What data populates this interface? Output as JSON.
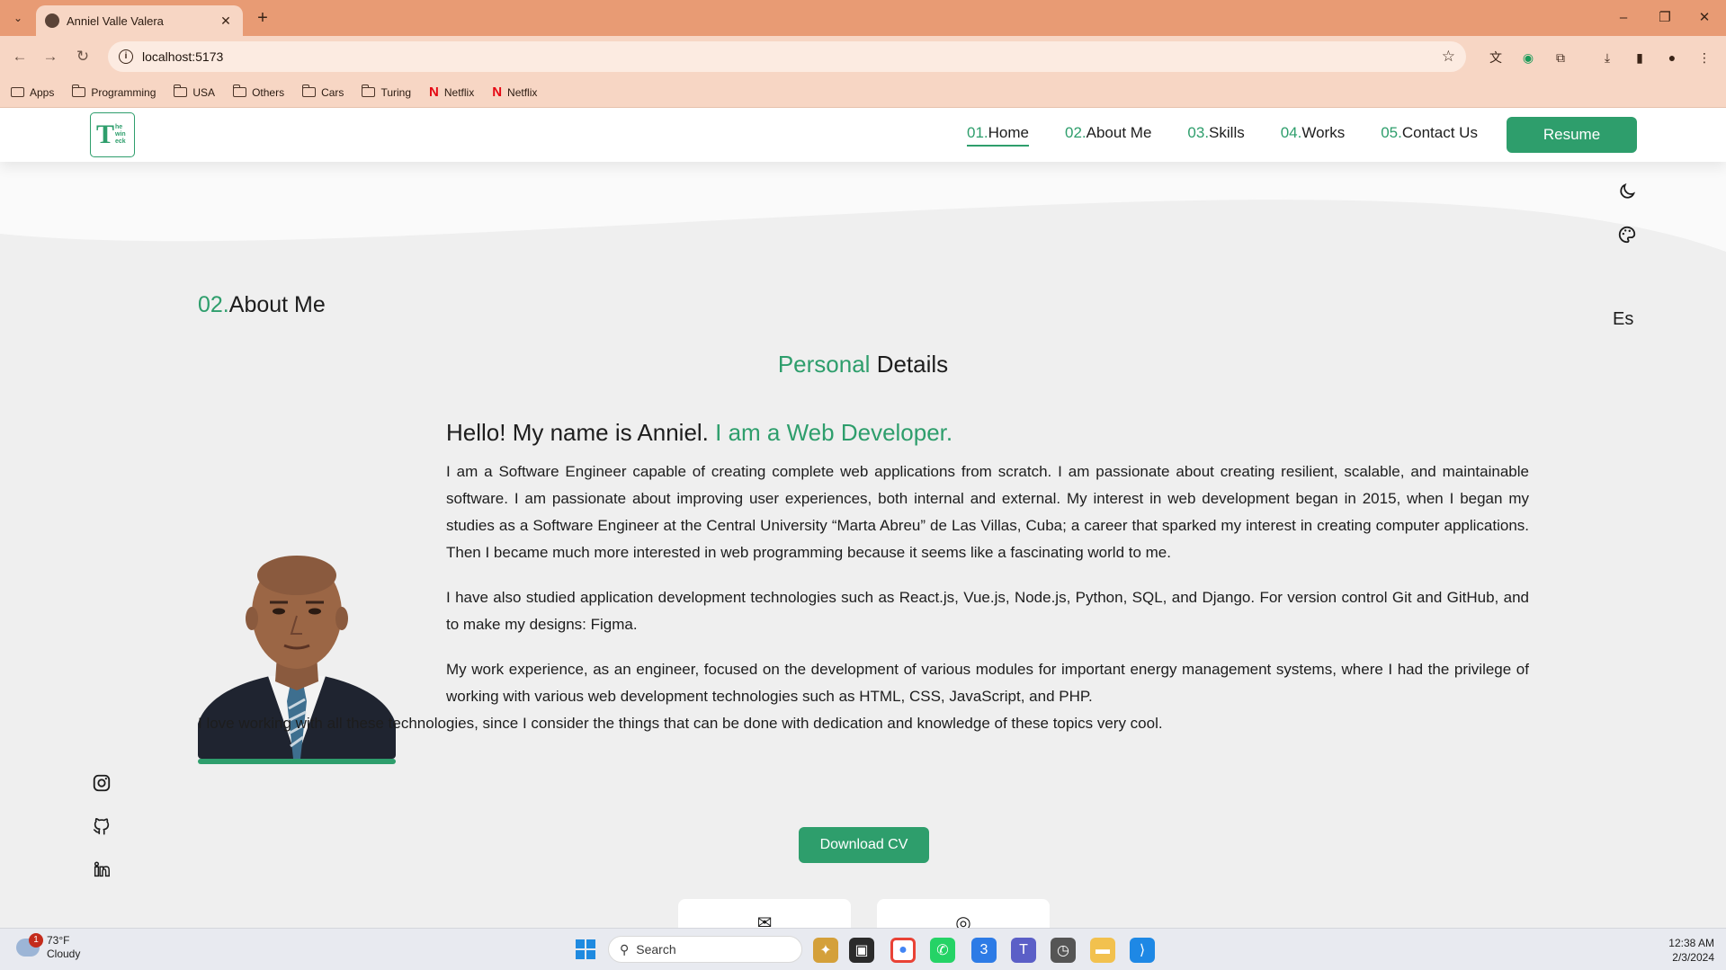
{
  "browser": {
    "tab_title": "Anniel Valle Valera",
    "url": "localhost:5173",
    "bookmarks": [
      {
        "label": "Apps",
        "icon": "apps-icon"
      },
      {
        "label": "Programming",
        "icon": "folder-icon"
      },
      {
        "label": "USA",
        "icon": "folder-icon"
      },
      {
        "label": "Others",
        "icon": "folder-icon"
      },
      {
        "label": "Cars",
        "icon": "folder-icon"
      },
      {
        "label": "Turing",
        "icon": "folder-icon"
      },
      {
        "label": "Netflix",
        "icon": "netflix-icon"
      },
      {
        "label": "Netflix",
        "icon": "netflix-icon"
      }
    ],
    "theme_color": "#e89b74"
  },
  "site": {
    "logo_letter": "T",
    "logo_small": [
      "he",
      "win",
      "eck"
    ],
    "nav": [
      {
        "num": "01.",
        "label": "Home",
        "active": true
      },
      {
        "num": "02.",
        "label": "About Me",
        "active": false
      },
      {
        "num": "03.",
        "label": "Skills",
        "active": false
      },
      {
        "num": "04.",
        "label": "Works",
        "active": false
      },
      {
        "num": "05.",
        "label": "Contact Us",
        "active": false
      }
    ],
    "resume_label": "Resume",
    "accent_color": "#2e9e6c",
    "language_label": "Es"
  },
  "about": {
    "section_num": "02.",
    "section_label": "About Me",
    "subtitle_accent": "Personal",
    "subtitle_rest": "Details",
    "greeting_main": "Hello! My name is Anniel.",
    "greeting_accent": "I am a Web Developer.",
    "paragraphs": [
      "I am a Software Engineer capable of creating complete web applications from scratch. I am passionate about creating resilient, scalable, and maintainable software. I am passionate about improving user experiences, both internal and external. My interest in web development began in 2015, when I began my studies as a Software Engineer at the Central University “Marta Abreu” de Las Villas, Cuba; a career that sparked my interest in creating computer applications. Then I became much more interested in web programming because it seems like a fascinating world to me.",
      "I have also studied application development technologies such as React.js, Vue.js, Node.js, Python, SQL, and Django. For version control Git and GitHub, and to make my designs: Figma.",
      "My work experience, as an engineer, focused on the development of various modules for important energy management systems, where I had the privilege of working with various web development technologies such as HTML, CSS, JavaScript, and PHP.",
      "I love working with all these technologies, since I consider the things that can be done with dedication and knowledge of these topics very cool."
    ],
    "download_label": "Download CV"
  },
  "taskbar": {
    "weather_temp": "73°F",
    "weather_desc": "Cloudy",
    "weather_badge": "1",
    "search_placeholder": "Search",
    "time": "12:38 AM",
    "date": "2/3/2024"
  }
}
